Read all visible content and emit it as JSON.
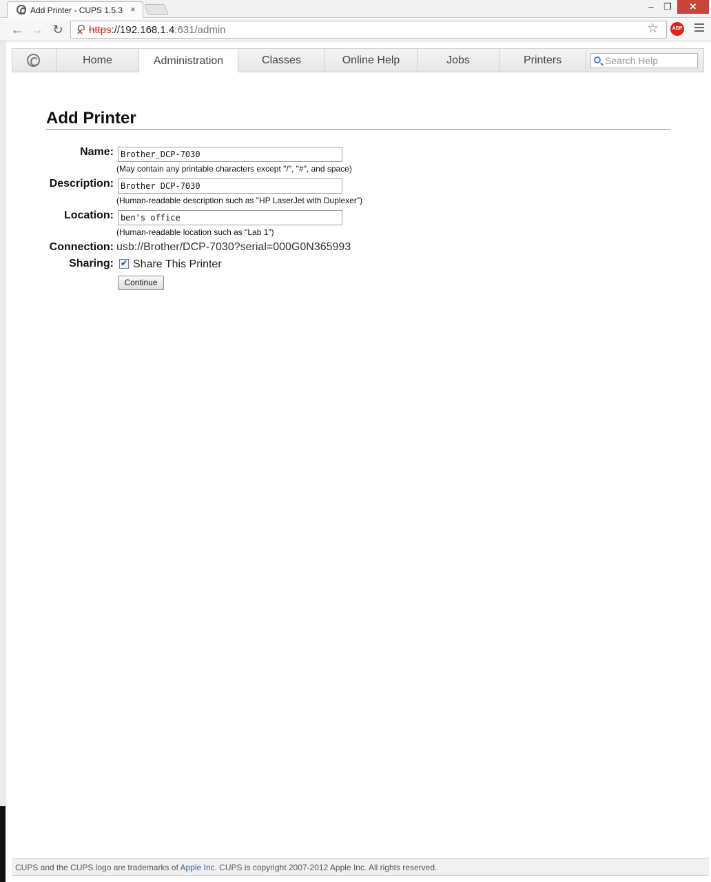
{
  "browser": {
    "tab_title": "Add Printer - CUPS 1.5.3",
    "tab_close": "×",
    "url_scheme": "https",
    "url_sep": "://",
    "url_host": "192.168.1.4",
    "url_path": ":631/admin",
    "abp_label": "ABP"
  },
  "cups_nav": {
    "items": [
      {
        "label": "Home"
      },
      {
        "label": "Administration",
        "active": true
      },
      {
        "label": "Classes"
      },
      {
        "label": "Online Help"
      },
      {
        "label": "Jobs"
      },
      {
        "label": "Printers"
      }
    ],
    "search_placeholder": "Search Help"
  },
  "form": {
    "title": "Add Printer",
    "name_label": "Name:",
    "name_value": "Brother_DCP-7030",
    "name_hint": "(May contain any printable characters except \"/\", \"#\", and space)",
    "description_label": "Description:",
    "description_value": "Brother DCP-7030",
    "description_hint": "(Human-readable description such as \"HP LaserJet with Duplexer\")",
    "location_label": "Location:",
    "location_value": "ben's office",
    "location_hint": "(Human-readable location such as \"Lab 1\")",
    "connection_label": "Connection:",
    "connection_value": "usb://Brother/DCP-7030?serial=000G0N365993",
    "sharing_label": "Sharing:",
    "sharing_checked": true,
    "sharing_text": "Share This Printer",
    "continue_label": "Continue"
  },
  "footer": {
    "text_before": "CUPS and the CUPS logo are trademarks of ",
    "link": "Apple Inc.",
    "text_after": " CUPS is copyright 2007-2012 Apple Inc. All rights reserved."
  }
}
